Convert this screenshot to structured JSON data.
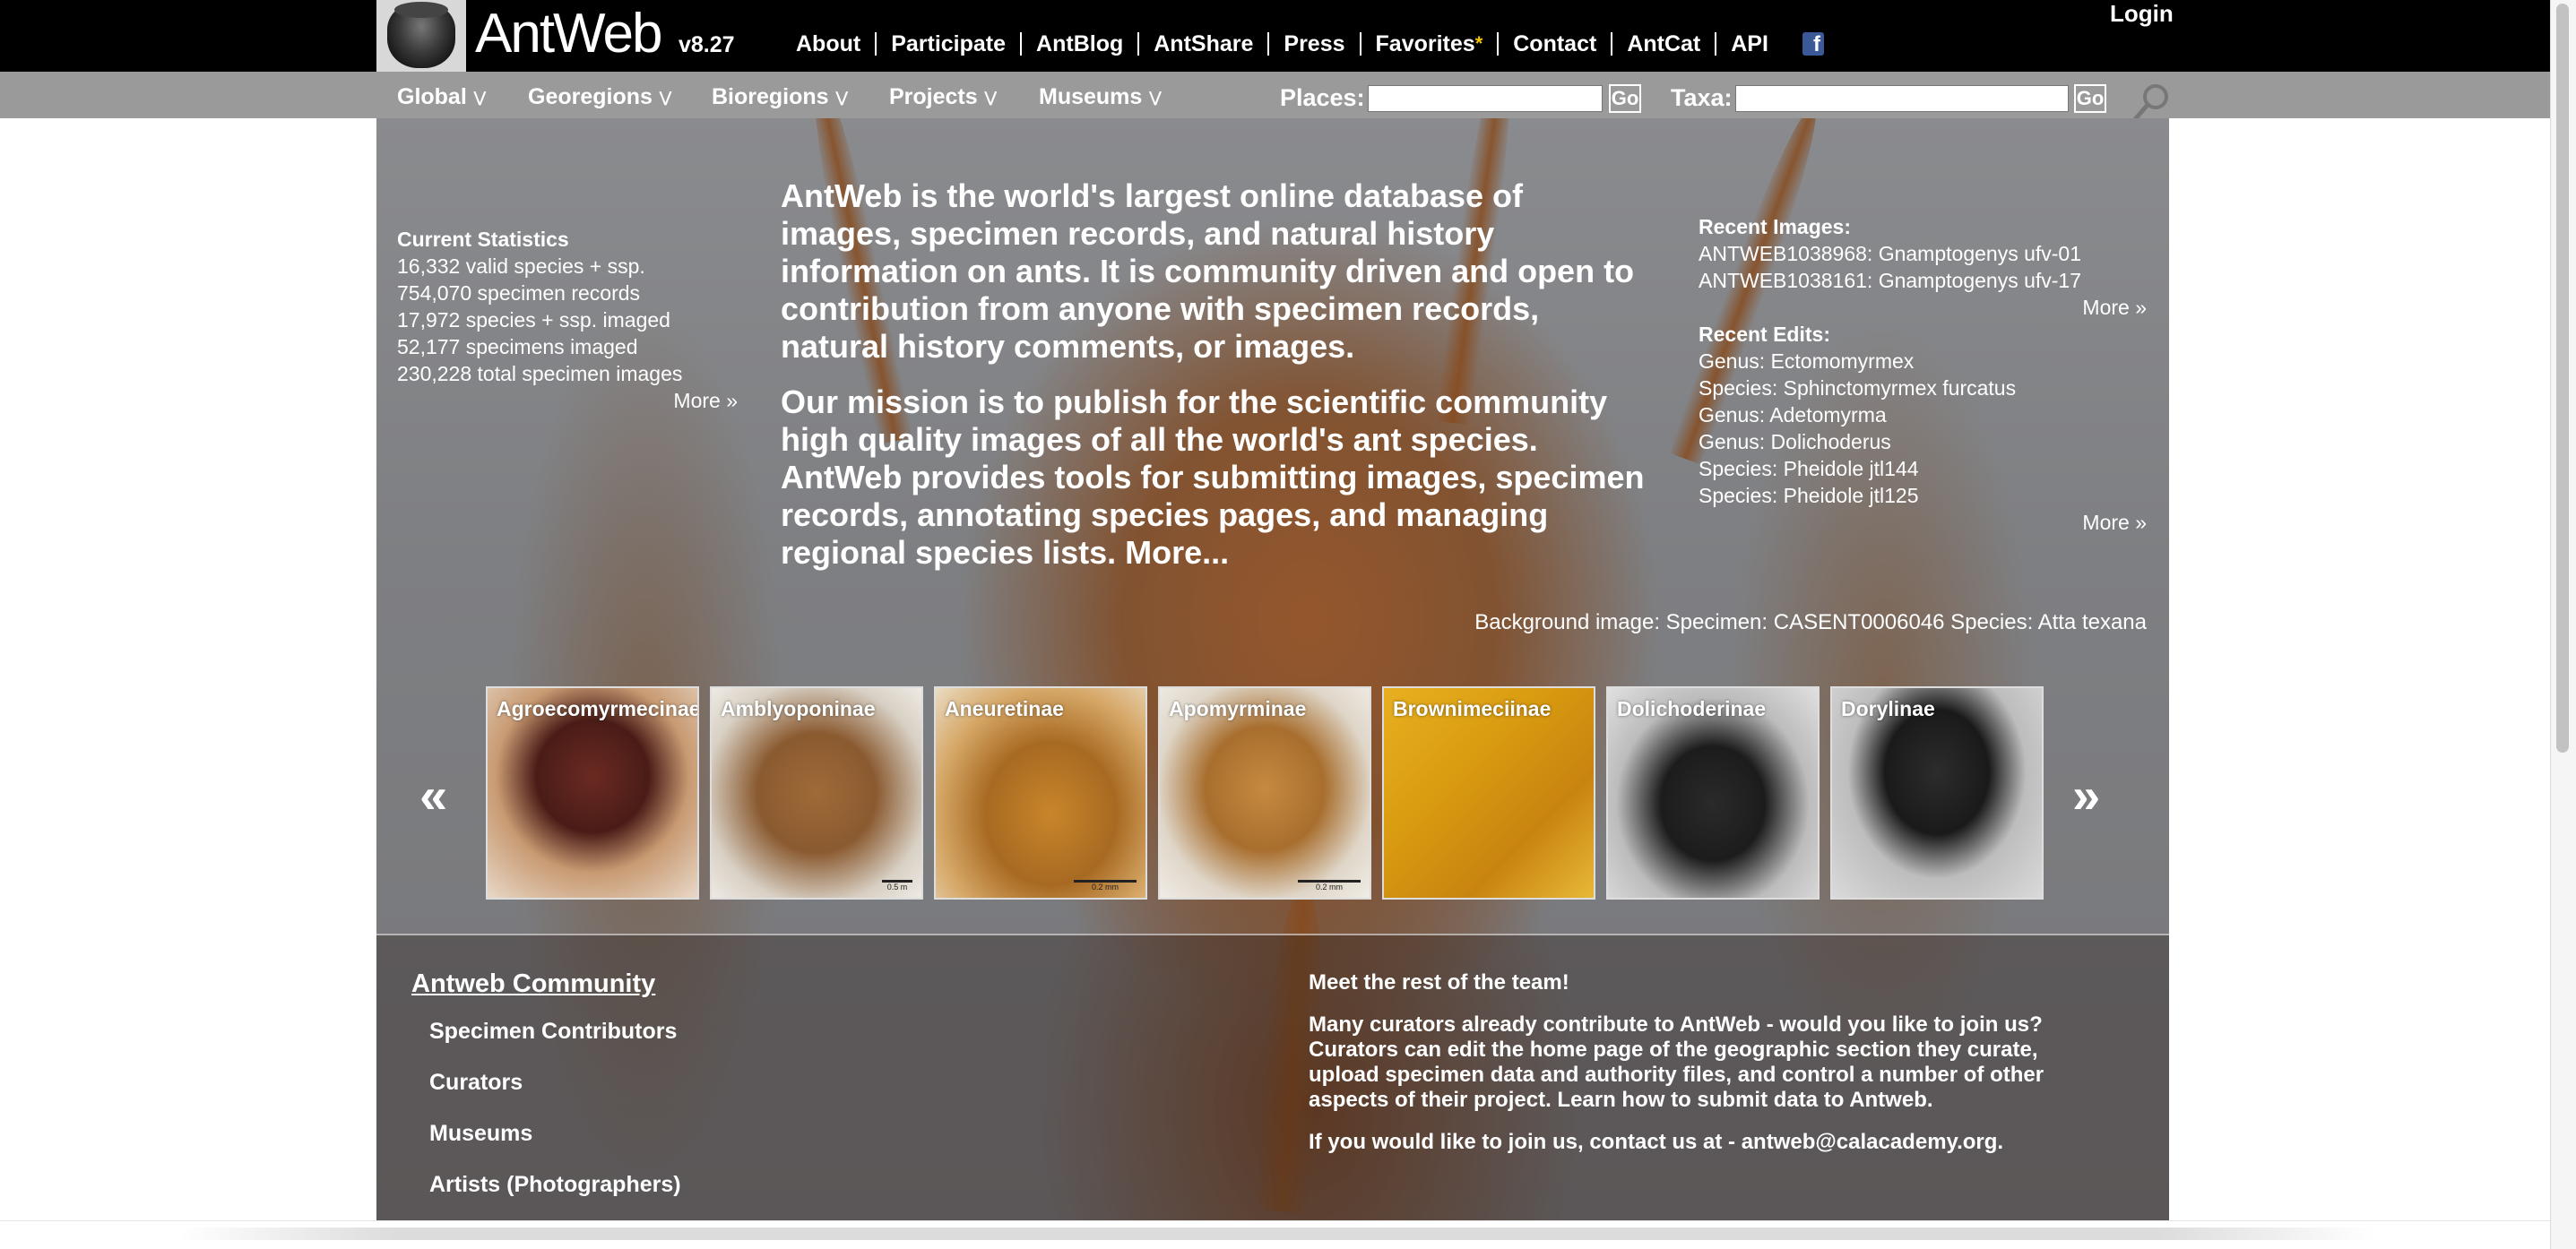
{
  "header": {
    "brand": "AntWeb",
    "version": "v8.27",
    "nav": [
      "About",
      "Participate",
      "AntBlog",
      "AntShare",
      "Press",
      "Favorites",
      "Contact",
      "AntCat",
      "API"
    ],
    "favorites_star": "*",
    "login": "Login"
  },
  "navbar": {
    "menus": [
      "Global",
      "Georegions",
      "Bioregions",
      "Projects",
      "Museums"
    ],
    "places_label": "Places:",
    "taxa_label": "Taxa:",
    "places_value": "",
    "taxa_value": "",
    "go_label": "Go"
  },
  "stats": {
    "title": "Current Statistics",
    "lines": [
      "16,332 valid species + ssp.",
      "754,070 specimen records",
      "17,972 species + ssp. imaged",
      "52,177 specimens imaged",
      "230,228 total specimen images"
    ],
    "more": "More »"
  },
  "intro": {
    "p1": "AntWeb is the world's largest online database of images, specimen records, and natural history information on ants. It is community driven and open to contribution from anyone with specimen records, natural history comments, or images.",
    "p2": "Our mission is to publish for the scientific community high quality images of all the world's ant species. AntWeb provides tools for submitting images, specimen records, annotating species pages, and managing regional species lists. More..."
  },
  "recent": {
    "images_title": "Recent Images:",
    "images": [
      "ANTWEB1038968: Gnamptogenys ufv-01",
      "ANTWEB1038161: Gnamptogenys ufv-17"
    ],
    "images_more": "More »",
    "edits_title": "Recent Edits:",
    "edits": [
      "Genus: Ectomomyrmex",
      "Species: Sphinctomyrmex furcatus",
      "Genus: Adetomyrma",
      "Genus: Dolichoderus",
      "Species: Pheidole jtl144",
      "Species: Pheidole jtl125"
    ],
    "edits_more": "More »"
  },
  "background_credit": "Background image: Specimen: CASENT0006046 Species: Atta texana",
  "carousel": {
    "prev": "«",
    "next": "»",
    "items": [
      {
        "label": "Agroecomyrmecinae",
        "scale": ""
      },
      {
        "label": "Amblyoponinae",
        "scale": "0.5 m"
      },
      {
        "label": "Aneuretinae",
        "scale": "0.2 mm"
      },
      {
        "label": "Apomyrminae",
        "scale": "0.2 mm"
      },
      {
        "label": "Brownimeciinae",
        "scale": ""
      },
      {
        "label": "Dolichoderinae",
        "scale": ""
      },
      {
        "label": "Dorylinae",
        "scale": ""
      }
    ]
  },
  "community": {
    "title": "Antweb Community",
    "links": [
      "Specimen Contributors",
      "Curators",
      "Museums",
      "Artists (Photographers)"
    ]
  },
  "team": {
    "p1": "Meet the rest of the team!",
    "p2": "Many curators already contribute to AntWeb - would you like to join us? Curators can edit the home page of the geographic section they curate, upload specimen data and authority files, and control a number of other aspects of their project. Learn how to submit data to Antweb.",
    "p3": "If you would like to join us, contact us at - antweb@calacademy.org."
  }
}
